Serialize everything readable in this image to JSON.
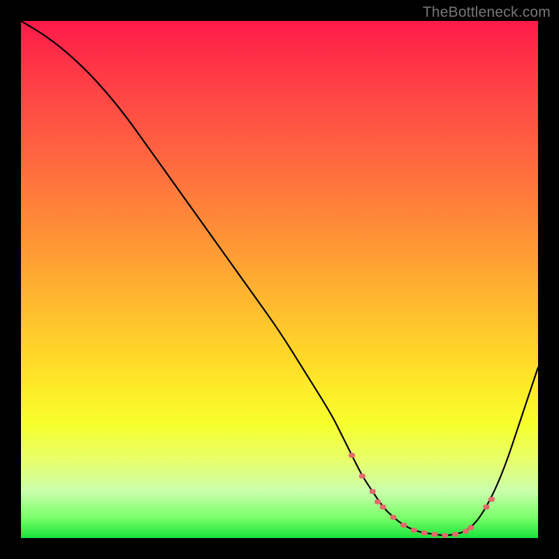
{
  "watermark": "TheBottleneck.com",
  "chart_data": {
    "type": "line",
    "title": "",
    "xlabel": "",
    "ylabel": "",
    "xlim": [
      0,
      100
    ],
    "ylim": [
      0,
      100
    ],
    "series": [
      {
        "name": "bottleneck-curve",
        "x": [
          0,
          5,
          10,
          15,
          20,
          25,
          30,
          35,
          40,
          45,
          50,
          55,
          60,
          62,
          64,
          66,
          68,
          70,
          72,
          74,
          76,
          78,
          80,
          82,
          84,
          86,
          88,
          90,
          92,
          94,
          96,
          98,
          100
        ],
        "values": [
          100,
          97,
          93,
          88,
          82,
          75,
          68,
          61,
          54,
          47,
          40,
          32,
          24,
          20,
          16,
          12,
          9,
          6,
          4,
          2.5,
          1.5,
          1,
          0.7,
          0.5,
          0.7,
          1.3,
          3,
          6,
          10,
          15,
          21,
          27,
          33
        ]
      }
    ],
    "highlight": {
      "name": "optimal-range-dots",
      "x": [
        64,
        66,
        68,
        69,
        70,
        72,
        74,
        76,
        78,
        80,
        82,
        84,
        86,
        87,
        90,
        91
      ],
      "values": [
        16,
        12,
        9,
        7,
        6,
        4,
        2.5,
        1.5,
        1,
        0.7,
        0.5,
        0.7,
        1.3,
        2.0,
        6,
        7.5
      ]
    },
    "colors": {
      "curve": "#000000",
      "dots": "#e46a6a",
      "gradient_top": "#ff1a49",
      "gradient_bottom": "#17e43b"
    }
  }
}
